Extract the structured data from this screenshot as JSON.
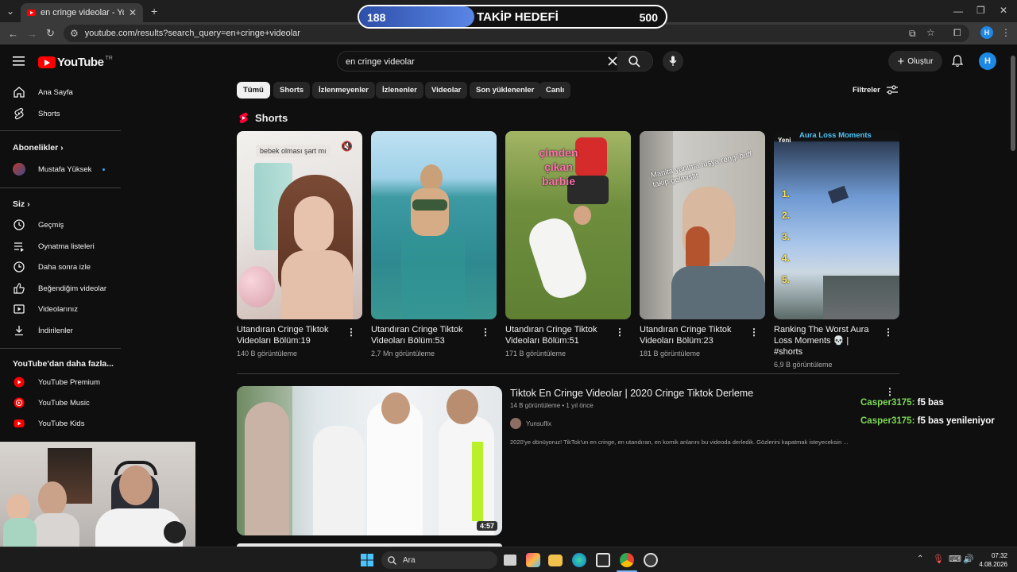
{
  "browser": {
    "tab_title": "en cringe videolar - YouTube",
    "url": "youtube.com/results?search_query=en+cringe+videolar",
    "profile_initial": "H"
  },
  "goal": {
    "title": "TAKİP HEDEFİ",
    "current": "188",
    "target": "500",
    "progress": 0.376
  },
  "header": {
    "logo_text": "YouTube",
    "logo_badge": "TR",
    "search_value": "en cringe videolar",
    "create_label": "Oluştur",
    "avatar_initial": "H"
  },
  "sidebar": {
    "main": [
      "Ana Sayfa",
      "Shorts"
    ],
    "subs_heading": "Abonelikler",
    "subs": [
      "Mustafa Yüksek"
    ],
    "you_heading": "Siz",
    "you": [
      "Geçmiş",
      "Oynatma listeleri",
      "Daha sonra izle",
      "Beğendiğim videolar",
      "Videolarınız",
      "İndirilenler"
    ],
    "more_heading": "YouTube'dan daha fazla...",
    "more": [
      "YouTube Premium",
      "YouTube Music",
      "YouTube Kids"
    ]
  },
  "chips": [
    "Tümü",
    "Shorts",
    "İzlenmeyenler",
    "İzlenenler",
    "Videolar",
    "Son yüklenenler",
    "Canlı"
  ],
  "filters_label": "Filtreler",
  "shorts": {
    "heading": "Shorts",
    "items": [
      {
        "title": "Utandıran Cringe Tiktok Videoları Bölüm:19",
        "views": "140 B görüntüleme",
        "overlay": "bebek olması şart mı"
      },
      {
        "title": "Utandıran Cringe Tiktok Videoları Bölüm:53",
        "views": "2,7 Mn görüntüleme",
        "overlay": ""
      },
      {
        "title": "Utandıran Cringe Tiktok Videoları Bölüm:51",
        "views": "171 B görüntüleme",
        "overlay": "çimden çıkan barbie"
      },
      {
        "title": "Utandıran Cringe Tiktok Videoları Bölüm:23",
        "views": "181 B görüntüleme",
        "overlay": "Manita yanıma fuşya rengi buff takıp gelmiştir"
      },
      {
        "title": "Ranking The Worst Aura Loss Moments 💀 | #shorts",
        "views": "6,9 B görüntüleme",
        "overlay": "Aura Loss Moments",
        "badge": "Yeni"
      }
    ]
  },
  "video": {
    "title": "Tiktok En Cringe Videolar | 2020 Cringe Tiktok Derleme",
    "meta": "14 B görüntüleme • 1 yıl önce",
    "channel": "Yunsuflix",
    "description": "2020'ye dönüyoruz! TikTok'un en cringe, en utandıran, en komik anlarını bu videoda derledik. Gözlerini kapatmak isteyeceksin ...",
    "duration": "4:57"
  },
  "chat": [
    {
      "user": "Casper3175:",
      "text": "f5 bas"
    },
    {
      "user": "Casper3175:",
      "text": "f5 bas yenileniyor"
    }
  ],
  "taskbar": {
    "search_label": "Ara",
    "time": "07:32",
    "date": "4.08.2026"
  }
}
